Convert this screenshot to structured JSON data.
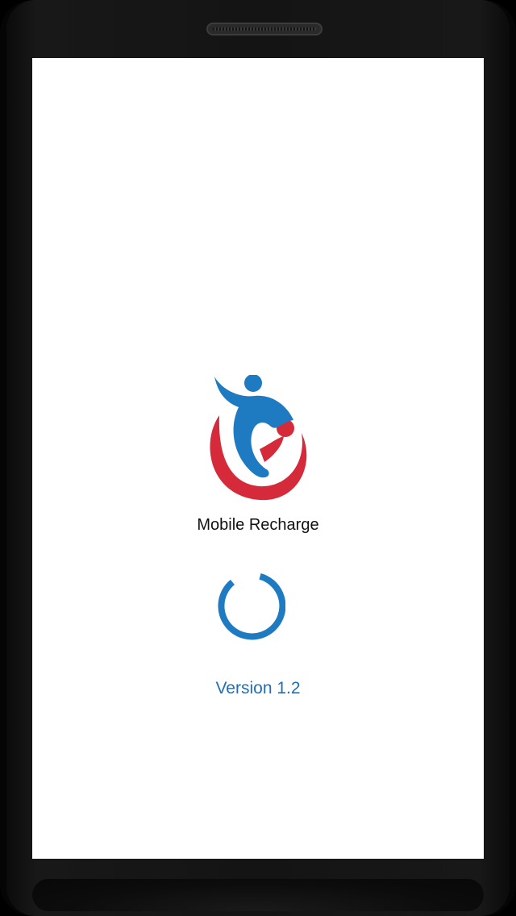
{
  "app": {
    "title": "Mobile Recharge",
    "logo_icon": "person-reaching-child-logo",
    "version_label": "Version 1.2"
  },
  "loading": {
    "indicator": "circular-spinner-icon"
  },
  "colors": {
    "screen_background": "#ffffff",
    "brand_blue": "#1e7bc1",
    "brand_red": "#d42a3a",
    "version_text": "#1e6fb8",
    "title_text": "#111111",
    "device_frame": "#141414"
  }
}
